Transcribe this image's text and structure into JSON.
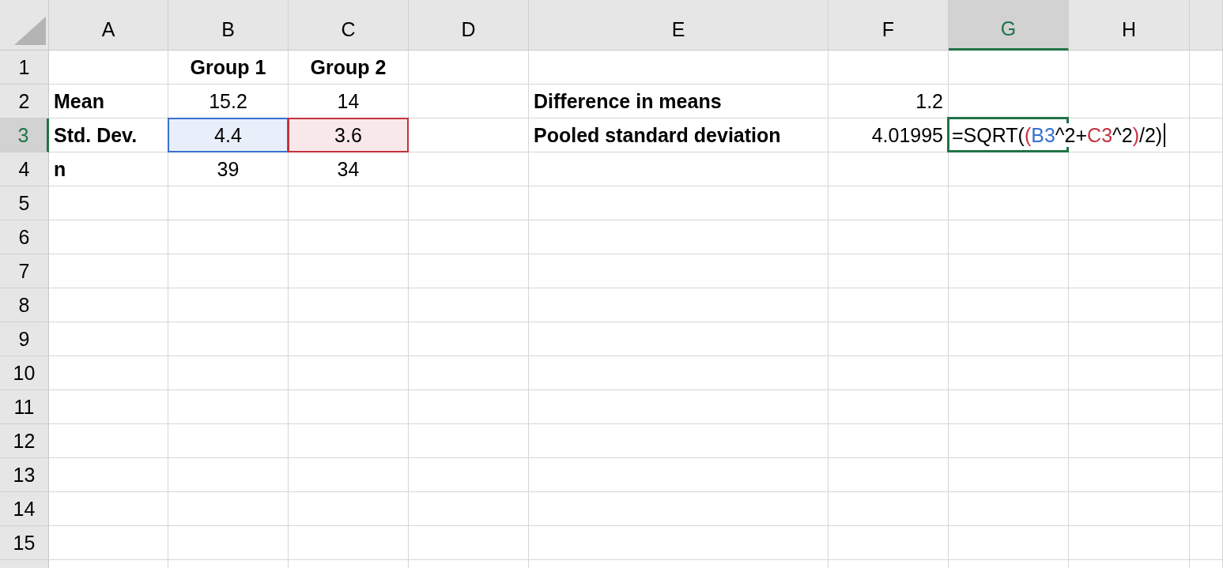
{
  "columns": [
    {
      "label": "A",
      "selected": false
    },
    {
      "label": "B",
      "selected": false
    },
    {
      "label": "C",
      "selected": false
    },
    {
      "label": "D",
      "selected": false
    },
    {
      "label": "E",
      "selected": false
    },
    {
      "label": "F",
      "selected": false
    },
    {
      "label": "G",
      "selected": true
    },
    {
      "label": "H",
      "selected": false
    }
  ],
  "rows": [
    {
      "label": "1",
      "selected": false,
      "B": {
        "text": "Group 1",
        "bold": true
      },
      "C": {
        "text": "Group 2",
        "bold": true
      }
    },
    {
      "label": "2",
      "selected": false,
      "A": {
        "text": "Mean",
        "bold": true
      },
      "B": {
        "text": "15.2",
        "bold": false
      },
      "C": {
        "text": "14",
        "bold": false
      },
      "E": {
        "text": "Difference in means",
        "bold": true
      },
      "F": {
        "text": "1.2",
        "bold": false
      }
    },
    {
      "label": "3",
      "selected": true,
      "A": {
        "text": "Std. Dev.",
        "bold": true
      },
      "B": {
        "text": "4.4",
        "bold": false,
        "color": "#3a6fd0"
      },
      "C": {
        "text": "3.6",
        "bold": false,
        "color": "#c4323f"
      },
      "E": {
        "text": "Pooled standard deviation",
        "bold": true
      },
      "F": {
        "text": "4.01995",
        "bold": false
      },
      "G": {
        "kind": "formula",
        "segments": [
          {
            "text": "=SQRT(",
            "color": "#000000"
          },
          {
            "text": "(",
            "color": "#c4323f"
          },
          {
            "text": "B3",
            "color": "#3a6fd0"
          },
          {
            "text": "^2+",
            "color": "#000000"
          },
          {
            "text": "C3",
            "color": "#c4323f"
          },
          {
            "text": "^2",
            "color": "#000000"
          },
          {
            "text": ")",
            "color": "#c4323f"
          },
          {
            "text": "/2)",
            "color": "#000000"
          }
        ]
      }
    },
    {
      "label": "4",
      "selected": false,
      "A": {
        "text": "n",
        "bold": true
      },
      "B": {
        "text": "39",
        "bold": false
      },
      "C": {
        "text": "34",
        "bold": false
      }
    },
    {
      "label": "5",
      "selected": false
    },
    {
      "label": "6",
      "selected": false
    },
    {
      "label": "7",
      "selected": false
    },
    {
      "label": "8",
      "selected": false
    },
    {
      "label": "9",
      "selected": false
    },
    {
      "label": "10",
      "selected": false
    },
    {
      "label": "11",
      "selected": false
    },
    {
      "label": "12",
      "selected": false
    },
    {
      "label": "13",
      "selected": false
    },
    {
      "label": "14",
      "selected": false
    },
    {
      "label": "15",
      "selected": false
    }
  ]
}
